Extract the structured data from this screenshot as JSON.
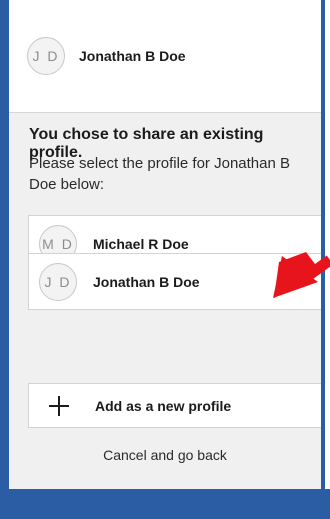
{
  "profile": {
    "initials": "J D",
    "name": "Jonathan B Doe"
  },
  "message": {
    "heading": "You chose to share an existing profile.",
    "description": "Please select the profile for Jonathan B Doe below:"
  },
  "options": [
    {
      "initials": "M D",
      "name": "Michael R Doe"
    },
    {
      "initials": "J D",
      "name": "Jonathan B Doe"
    }
  ],
  "actions": {
    "add_label": "Add as a new profile",
    "cancel_label": "Cancel and go back"
  },
  "colors": {
    "frame": "#2a5da3",
    "panel": "#f0f0f0",
    "arrow": "#e8141b"
  },
  "icons": {
    "add": "plus-icon",
    "annotation": "red-arrow-icon"
  }
}
